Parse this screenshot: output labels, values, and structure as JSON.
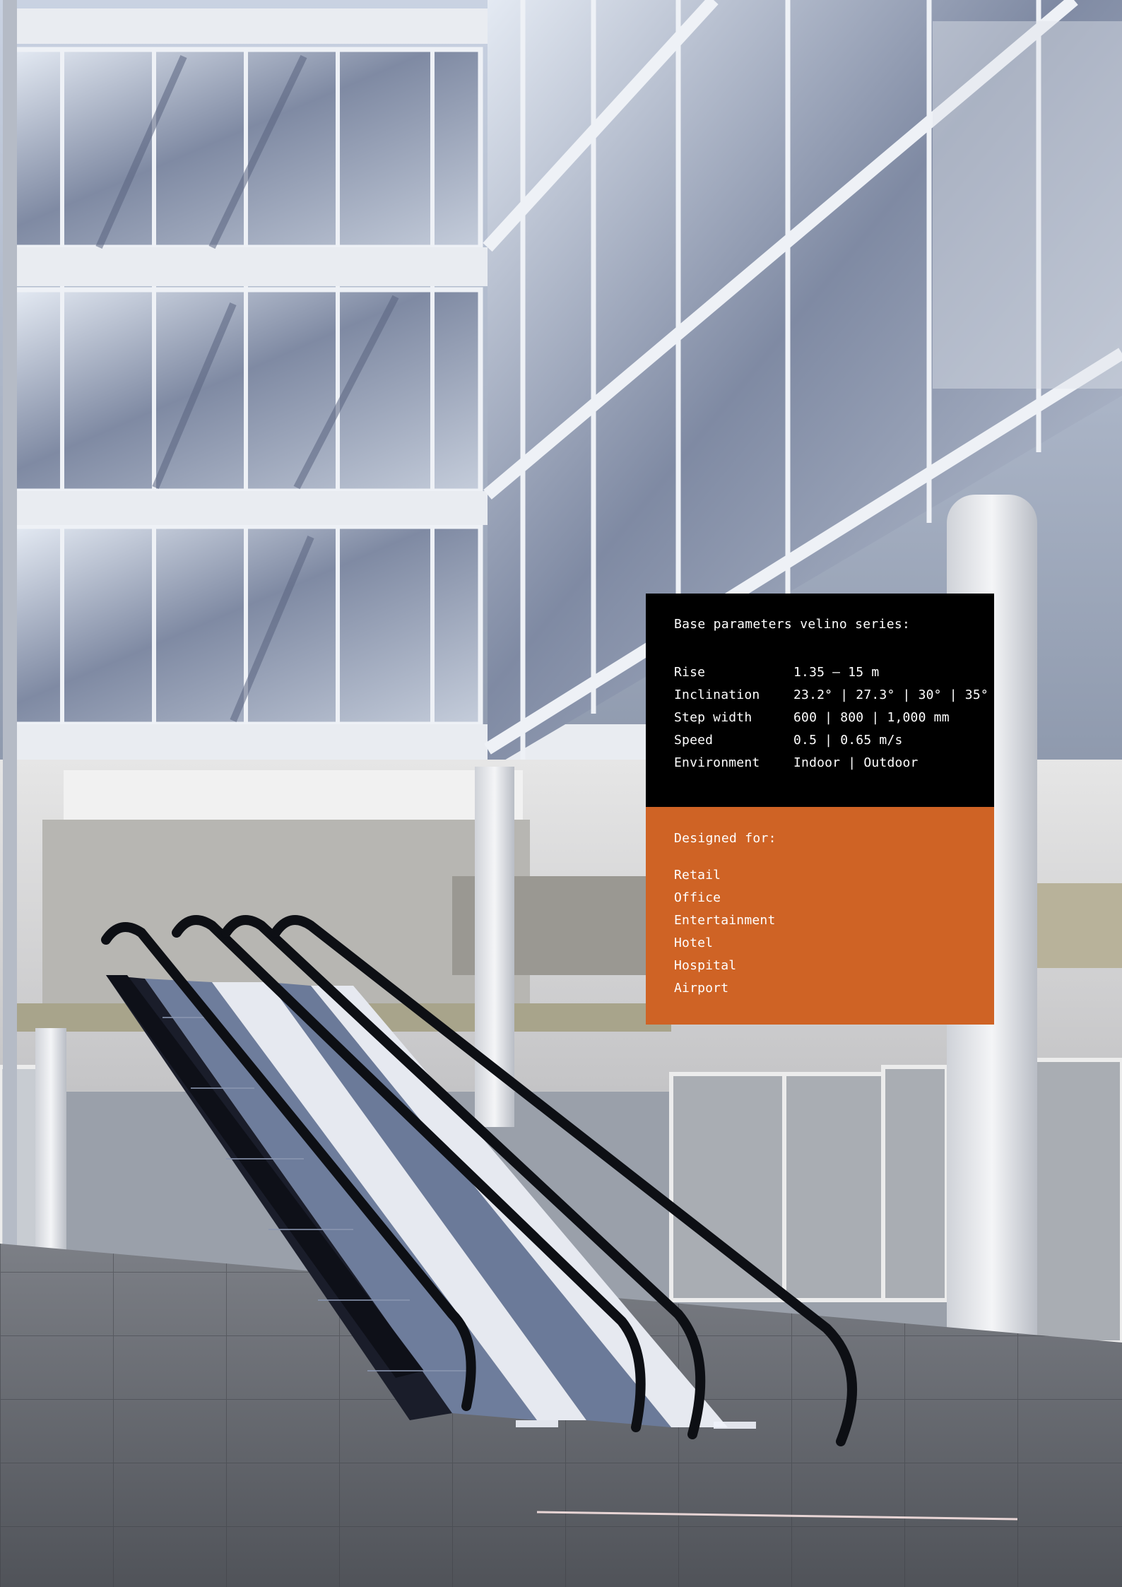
{
  "spec_panel": {
    "title": "Base parameters velino series:",
    "rows": [
      {
        "label": "Rise",
        "value": "1.35 – 15 m"
      },
      {
        "label": "Inclination",
        "value": "23.2° | 27.3° | 30° | 35°"
      },
      {
        "label": "Step width",
        "value": "600 | 800 | 1,000 mm"
      },
      {
        "label": "Speed",
        "value": "0.5 | 0.65 m/s"
      },
      {
        "label": "Environment",
        "value": "Indoor | Outdoor"
      }
    ]
  },
  "usage_panel": {
    "title": "Designed for:",
    "items": [
      "Retail",
      "Office",
      "Entertainment",
      "Hotel",
      "Hospital",
      "Airport"
    ]
  },
  "colors": {
    "dark_panel": "#000000",
    "accent_orange": "#cf6325",
    "text": "#ffffff"
  }
}
